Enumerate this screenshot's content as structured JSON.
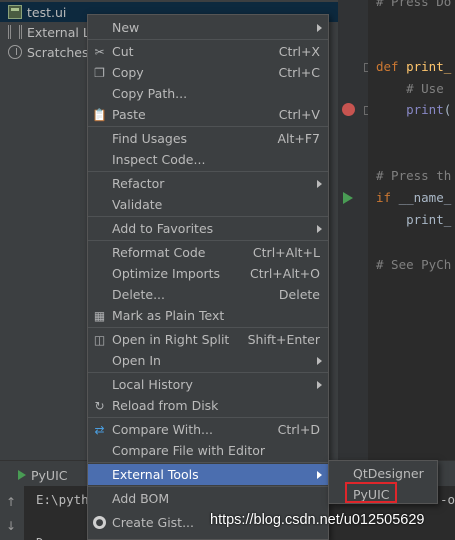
{
  "project_tree": {
    "items": [
      {
        "label": "test.ui",
        "icon": "ui-file-icon"
      },
      {
        "label": "External Libra",
        "icon": "library-icon"
      },
      {
        "label": "Scratches and",
        "icon": "scratches-icon"
      }
    ]
  },
  "editor": {
    "lines": [
      {
        "text": "# Press Do",
        "style": "comment"
      },
      {
        "text": "def print_",
        "style": "def"
      },
      {
        "text": "    # Use",
        "style": "comment"
      },
      {
        "text": "    print(",
        "style": "print"
      },
      {
        "text": "# Press th",
        "style": "comment"
      },
      {
        "text": "if __name_",
        "style": "if"
      },
      {
        "text": "    print_",
        "style": "plain"
      },
      {
        "text": "# See PyCh",
        "style": "comment"
      }
    ]
  },
  "context_menu": {
    "items": [
      {
        "label": "New",
        "shortcut": "",
        "submenu": true,
        "icon": ""
      },
      {
        "label": "Cut",
        "shortcut": "Ctrl+X",
        "submenu": false,
        "icon": "scissors-icon"
      },
      {
        "label": "Copy",
        "shortcut": "Ctrl+C",
        "submenu": false,
        "icon": "copy-icon"
      },
      {
        "label": "Copy Path...",
        "shortcut": "",
        "submenu": false,
        "icon": ""
      },
      {
        "label": "Paste",
        "shortcut": "Ctrl+V",
        "submenu": false,
        "icon": "paste-icon"
      },
      {
        "label": "Find Usages",
        "shortcut": "Alt+F7",
        "submenu": false,
        "icon": ""
      },
      {
        "label": "Inspect Code...",
        "shortcut": "",
        "submenu": false,
        "icon": ""
      },
      {
        "label": "Refactor",
        "shortcut": "",
        "submenu": true,
        "icon": ""
      },
      {
        "label": "Validate",
        "shortcut": "",
        "submenu": false,
        "icon": ""
      },
      {
        "label": "Add to Favorites",
        "shortcut": "",
        "submenu": true,
        "icon": ""
      },
      {
        "label": "Reformat Code",
        "shortcut": "Ctrl+Alt+L",
        "submenu": false,
        "icon": ""
      },
      {
        "label": "Optimize Imports",
        "shortcut": "Ctrl+Alt+O",
        "submenu": false,
        "icon": ""
      },
      {
        "label": "Delete...",
        "shortcut": "Delete",
        "submenu": false,
        "icon": ""
      },
      {
        "label": "Mark as Plain Text",
        "shortcut": "",
        "submenu": false,
        "icon": "plain-text-icon"
      },
      {
        "label": "Open in Right Split",
        "shortcut": "Shift+Enter",
        "submenu": false,
        "icon": "split-icon"
      },
      {
        "label": "Open In",
        "shortcut": "",
        "submenu": true,
        "icon": ""
      },
      {
        "label": "Local History",
        "shortcut": "",
        "submenu": true,
        "icon": ""
      },
      {
        "label": "Reload from Disk",
        "shortcut": "",
        "submenu": false,
        "icon": "reload-icon"
      },
      {
        "label": "Compare With...",
        "shortcut": "Ctrl+D",
        "submenu": false,
        "icon": "compare-icon"
      },
      {
        "label": "Compare File with Editor",
        "shortcut": "",
        "submenu": false,
        "icon": ""
      },
      {
        "label": "External Tools",
        "shortcut": "",
        "submenu": true,
        "icon": ""
      },
      {
        "label": "Add BOM",
        "shortcut": "",
        "submenu": false,
        "icon": ""
      },
      {
        "label": "Create Gist...",
        "shortcut": "",
        "submenu": false,
        "icon": "github-icon"
      }
    ]
  },
  "submenu": {
    "items": [
      "QtDesigner",
      "PyUIC"
    ]
  },
  "run_panel": {
    "tab_label": "PyUIC",
    "console_lines": [
      "E:\\pyth",
      "D",
      "-o"
    ]
  },
  "watermark": "https://blog.csdn.net/u012505629",
  "colors": {
    "highlight": "#4b6eaf",
    "annotation_box": "#e0262b"
  }
}
